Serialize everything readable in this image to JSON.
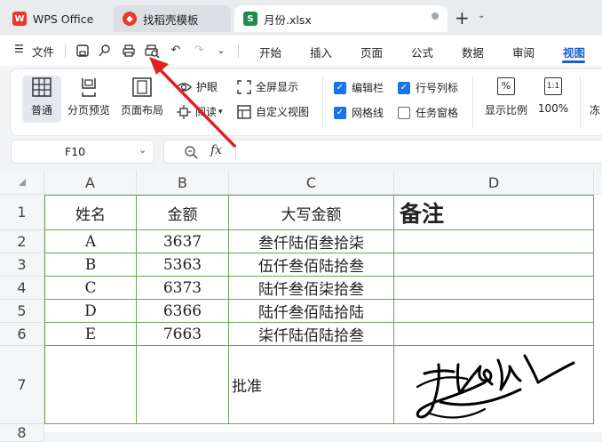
{
  "tabs": {
    "wps_label": "WPS Office",
    "template_label": "找稻壳模板",
    "file_label": "月份.xlsx",
    "new_tab": "+",
    "tab_menu": "⌄"
  },
  "menu": {
    "hamburger": "☰",
    "file": "文件",
    "tabs": [
      "开始",
      "插入",
      "页面",
      "公式",
      "数据",
      "审阅",
      "视图"
    ]
  },
  "ribbon": {
    "normal": "普通",
    "page_break": "分页预览",
    "page_layout": "页面布局",
    "eye_protect": "护眼",
    "reading": "阅读",
    "fullscreen": "全屏显示",
    "custom_view": "自定义视图",
    "formula_bar": "编辑栏",
    "gridlines": "网格线",
    "headings": "行号列标",
    "task_pane": "任务窗格",
    "zoom_ratio": "显示比例",
    "hundred": "100%",
    "hundred_icon": "1:1",
    "freeze_partial": "冻",
    "checked": {
      "formula_bar": true,
      "gridlines": true,
      "headings": true,
      "task_pane": false
    }
  },
  "formula": {
    "name_box": "F10",
    "fx": "fx",
    "value": ""
  },
  "sheet": {
    "columns": [
      "A",
      "B",
      "C",
      "D"
    ],
    "rows": [
      "1",
      "2",
      "3",
      "4",
      "5",
      "6",
      "7",
      "8"
    ],
    "header_row": [
      "姓名",
      "金额",
      "大写金额",
      "备注"
    ],
    "data": [
      [
        "A",
        "3637",
        "叁仟陆佰叁拾柒",
        ""
      ],
      [
        "B",
        "5363",
        "伍仟叁佰陆拾叁",
        ""
      ],
      [
        "C",
        "6373",
        "陆仟叁佰柒拾叁",
        ""
      ],
      [
        "D",
        "6366",
        "陆仟叁佰陆拾陆",
        ""
      ],
      [
        "E",
        "7663",
        "柒仟陆佰陆拾叁",
        ""
      ]
    ],
    "row7_c": "批准"
  },
  "colors": {
    "accent": "#1a5fd0",
    "grid_line": "#6aa45a",
    "arrow": "#e02020",
    "wps_red": "#e8392c",
    "excel_green": "#1e8c4e"
  }
}
